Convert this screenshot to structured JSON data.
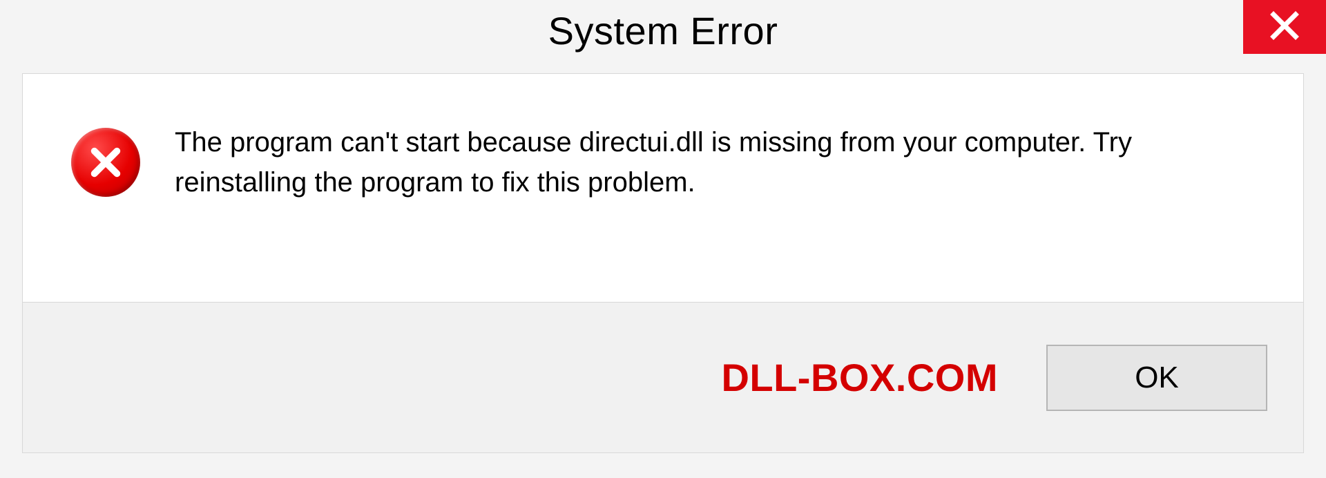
{
  "titlebar": {
    "title": "System Error"
  },
  "content": {
    "message": "The program can't start because directui.dll is missing from your computer. Try reinstalling the program to fix this problem."
  },
  "footer": {
    "watermark": "DLL-BOX.COM",
    "ok_label": "OK"
  }
}
